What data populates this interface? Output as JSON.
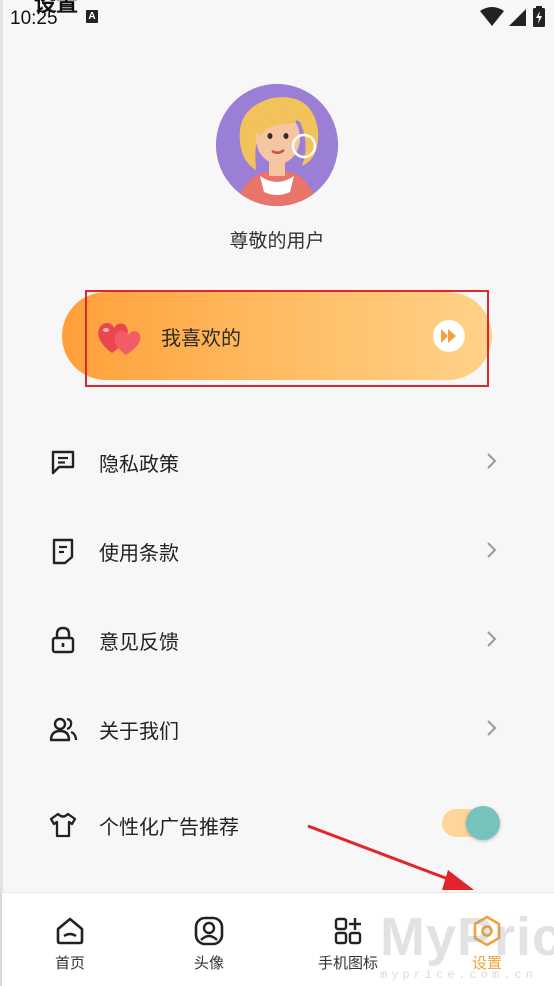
{
  "status_bar": {
    "time": "10:25",
    "notification_badge": "A",
    "icons": [
      "wifi-icon",
      "signal-icon",
      "battery-charging-icon"
    ]
  },
  "page": {
    "title": "设置"
  },
  "profile": {
    "username": "尊敬的用户"
  },
  "favorites": {
    "label": "我喜欢的",
    "icon": "hearts-icon",
    "action_icon": "fast-forward-icon"
  },
  "menu": [
    {
      "label": "隐私政策",
      "icon": "message-square-icon",
      "has_chevron": true
    },
    {
      "label": "使用条款",
      "icon": "document-icon",
      "has_chevron": true
    },
    {
      "label": "意见反馈",
      "icon": "lock-icon",
      "has_chevron": true
    },
    {
      "label": "关于我们",
      "icon": "users-icon",
      "has_chevron": true
    },
    {
      "label": "个性化广告推荐",
      "icon": "tshirt-icon",
      "toggle": true
    }
  ],
  "tabs": [
    {
      "label": "首页",
      "icon": "home-icon",
      "active": false
    },
    {
      "label": "头像",
      "icon": "avatar-icon",
      "active": false
    },
    {
      "label": "手机图标",
      "icon": "apps-icon",
      "active": false
    },
    {
      "label": "设置",
      "icon": "hexagon-settings-icon",
      "active": true
    }
  ],
  "colors": {
    "accent": "#f2a23a",
    "toggle_knob": "#76c3bc",
    "highlight": "#e0262b"
  },
  "watermark": {
    "text": "MyPrice",
    "sub": "myprice.com.cn"
  }
}
